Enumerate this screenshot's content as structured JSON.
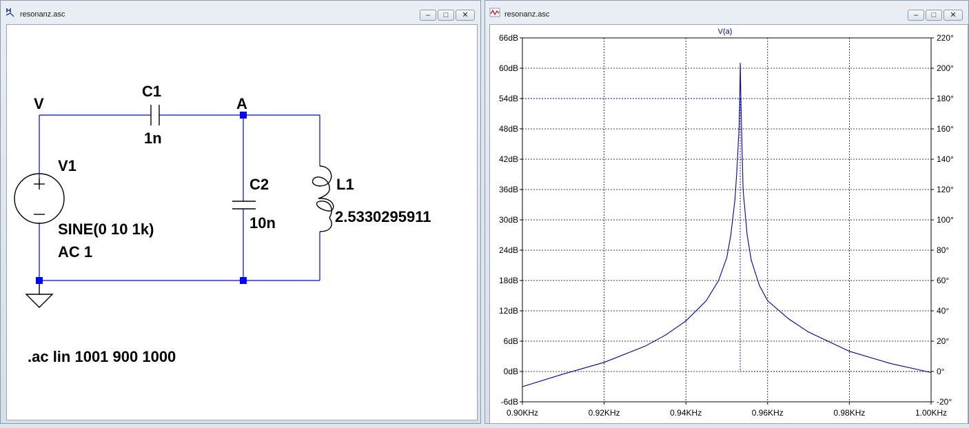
{
  "schematic_window": {
    "title": "resonanz.asc",
    "buttons": {
      "minimize": "–",
      "maximize": "□",
      "close": "✕"
    },
    "labels": {
      "node_v": "V",
      "node_a": "A",
      "c1_name": "C1",
      "c1_value": "1n",
      "v1_name": "V1",
      "v1_value_line1": "SINE(0 10 1k)",
      "v1_value_line2": "AC 1",
      "c2_name": "C2",
      "c2_value": "10n",
      "l1_name": "L1",
      "l1_value": "2.5330295911",
      "directive": ".ac lin 1001 900 1000"
    }
  },
  "waveform_window": {
    "title": "resonanz.asc",
    "buttons": {
      "minimize": "–",
      "maximize": "□",
      "close": "✕"
    },
    "trace_label": "V(a)"
  },
  "chart_data": {
    "type": "line",
    "series": [
      {
        "name": "V(a)",
        "color": "#0000a0",
        "x": [
          0.9,
          0.91,
          0.92,
          0.93,
          0.935,
          0.94,
          0.945,
          0.948,
          0.95,
          0.951,
          0.952,
          0.9525,
          0.953,
          0.9532,
          0.9533,
          0.9535,
          0.954,
          0.955,
          0.956,
          0.958,
          0.96,
          0.965,
          0.97,
          0.98,
          0.99,
          1.0
        ],
        "values": [
          -3.0,
          -0.5,
          1.8,
          5.0,
          7.2,
          10.0,
          14.0,
          18.0,
          22.5,
          27.0,
          34.0,
          40.0,
          48.0,
          55.0,
          61.0,
          52.0,
          36.0,
          27.0,
          22.0,
          17.0,
          14.0,
          10.5,
          7.8,
          4.0,
          1.6,
          -0.2
        ]
      }
    ],
    "xlabel": "",
    "ylabel": "",
    "x_unit": "KHz",
    "x_ticks": [
      "0.90KHz",
      "0.92KHz",
      "0.94KHz",
      "0.96KHz",
      "0.98KHz",
      "1.00KHz"
    ],
    "y_ticks_left": [
      "66dB",
      "60dB",
      "54dB",
      "48dB",
      "42dB",
      "36dB",
      "30dB",
      "24dB",
      "18dB",
      "12dB",
      "6dB",
      "0dB",
      "-6dB"
    ],
    "y_ticks_right": [
      "220°",
      "200°",
      "180°",
      "160°",
      "140°",
      "120°",
      "100°",
      "80°",
      "60°",
      "40°",
      "20°",
      "0°",
      "-20°"
    ],
    "xlim": [
      0.9,
      1.0
    ],
    "ylim": [
      -6,
      66
    ],
    "y2lim": [
      -20,
      220
    ],
    "phase_marker": {
      "x": 0.9533,
      "level_db": 54,
      "floor_db": 0
    },
    "grid": true,
    "legend": "top-center"
  }
}
